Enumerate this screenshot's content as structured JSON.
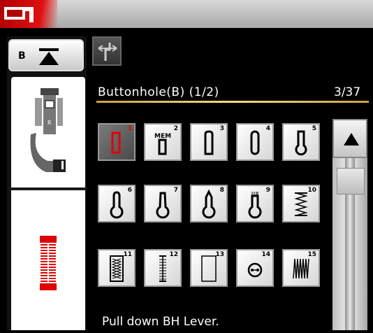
{
  "header": {
    "logo_icon": "sewing-machine-icon"
  },
  "side": {
    "b_tab_label": "B",
    "b_tab_icon": "lever-down-icon",
    "foot_icon": "buttonhole-foot-icon",
    "stitch_preview_icon": "buttonhole-stitch-preview-icon"
  },
  "mode_button_icon": "mirror-stitch-icon",
  "title": "Buttonhole(B) (1/2)",
  "page_counter": "3/37",
  "stitches": [
    {
      "number": "1",
      "icon": "buttonhole-square-icon",
      "selected": true
    },
    {
      "number": "2",
      "icon": "buttonhole-memory-icon",
      "label": "MEM"
    },
    {
      "number": "3",
      "icon": "buttonhole-round-icon"
    },
    {
      "number": "4",
      "icon": "buttonhole-round-both-icon"
    },
    {
      "number": "5",
      "icon": "keyhole-icon"
    },
    {
      "number": "6",
      "icon": "keyhole-round-icon"
    },
    {
      "number": "7",
      "icon": "keyhole-tapered-icon"
    },
    {
      "number": "8",
      "icon": "keyhole-pointed-icon"
    },
    {
      "number": "9",
      "icon": "keyhole-bartack-icon"
    },
    {
      "number": "10",
      "icon": "zigzag-buttonhole-icon"
    },
    {
      "number": "11",
      "icon": "stretch-buttonhole-icon"
    },
    {
      "number": "12",
      "icon": "heirloom-buttonhole-icon"
    },
    {
      "number": "13",
      "icon": "bound-buttonhole-icon"
    },
    {
      "number": "14",
      "icon": "button-sewing-icon"
    },
    {
      "number": "15",
      "icon": "darning-icon"
    }
  ],
  "scroll_up_icon": "triangle-up-icon",
  "status_message": "Pull down BH Lever.",
  "colors": {
    "accent_red": "#e00000",
    "gold_line": "#e8c873"
  }
}
